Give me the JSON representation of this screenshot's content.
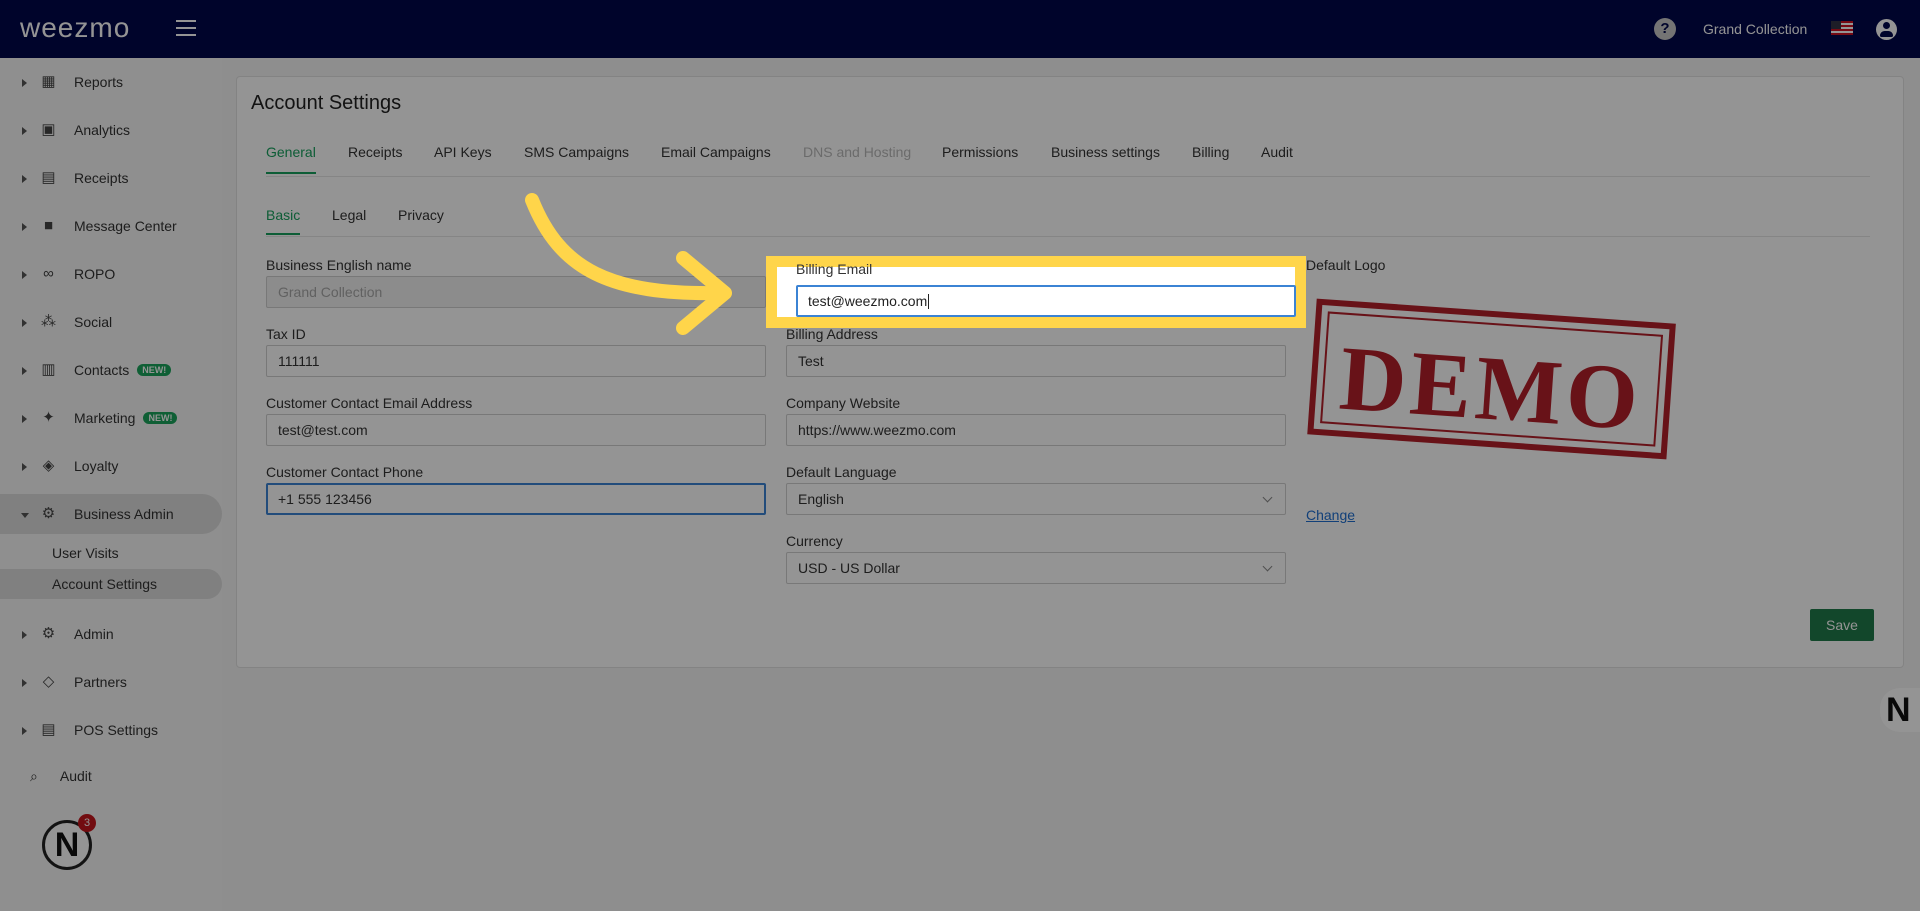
{
  "app": {
    "logo_text": "weezmo",
    "account_name": "Grand Collection"
  },
  "sidebar": {
    "items": [
      {
        "label": "Reports",
        "icon": "dashboard-icon"
      },
      {
        "label": "Analytics",
        "icon": "analytics-icon"
      },
      {
        "label": "Receipts",
        "icon": "receipt-icon"
      },
      {
        "label": "Message Center",
        "icon": "chat-icon"
      },
      {
        "label": "ROPO",
        "icon": "infinity-icon"
      },
      {
        "label": "Social",
        "icon": "group-icon"
      },
      {
        "label": "Contacts",
        "icon": "contacts-icon",
        "badge": "NEW!"
      },
      {
        "label": "Marketing",
        "icon": "megaphone-icon",
        "badge": "NEW!"
      },
      {
        "label": "Loyalty",
        "icon": "tag-icon"
      },
      {
        "label": "Business Admin",
        "icon": "gear-icon"
      },
      {
        "label": "Admin",
        "icon": "gear-icon"
      },
      {
        "label": "Partners",
        "icon": "handshake-icon"
      },
      {
        "label": "POS Settings",
        "icon": "register-icon"
      }
    ],
    "sub_items": [
      "User Visits",
      "Account Settings"
    ],
    "audit_label": "Audit",
    "notification_count": "3"
  },
  "page": {
    "title": "Account Settings",
    "tabs": [
      "General",
      "Receipts",
      "API Keys",
      "SMS Campaigns",
      "Email Campaigns",
      "DNS and Hosting",
      "Permissions",
      "Business settings",
      "Billing",
      "Audit"
    ],
    "subtabs": [
      "Basic",
      "Legal",
      "Privacy"
    ]
  },
  "form": {
    "business_name": {
      "label": "Business English name",
      "value": "Grand Collection"
    },
    "tax_id": {
      "label": "Tax ID",
      "value": "111111"
    },
    "contact_email": {
      "label": "Customer Contact Email Address",
      "value": "test@test.com"
    },
    "contact_phone": {
      "label": "Customer Contact Phone",
      "value": "+1 555 123456"
    },
    "billing_email": {
      "label": "Billing Email",
      "value": "test@weezmo.com"
    },
    "billing_address": {
      "label": "Billing Address",
      "value": "Test"
    },
    "website": {
      "label": "Company Website",
      "value": "https://www.weezmo.com"
    },
    "language": {
      "label": "Default Language",
      "value": "English"
    },
    "currency": {
      "label": "Currency",
      "value": "USD - US Dollar"
    },
    "logo": {
      "label": "Default Logo",
      "stamp_text": "DEMO",
      "change_label": "Change"
    },
    "save_label": "Save"
  },
  "colors": {
    "topbar": "#00074a",
    "accent_green": "#17a05d",
    "highlight": "#ffd54a",
    "stamp_red": "#b3202a"
  }
}
